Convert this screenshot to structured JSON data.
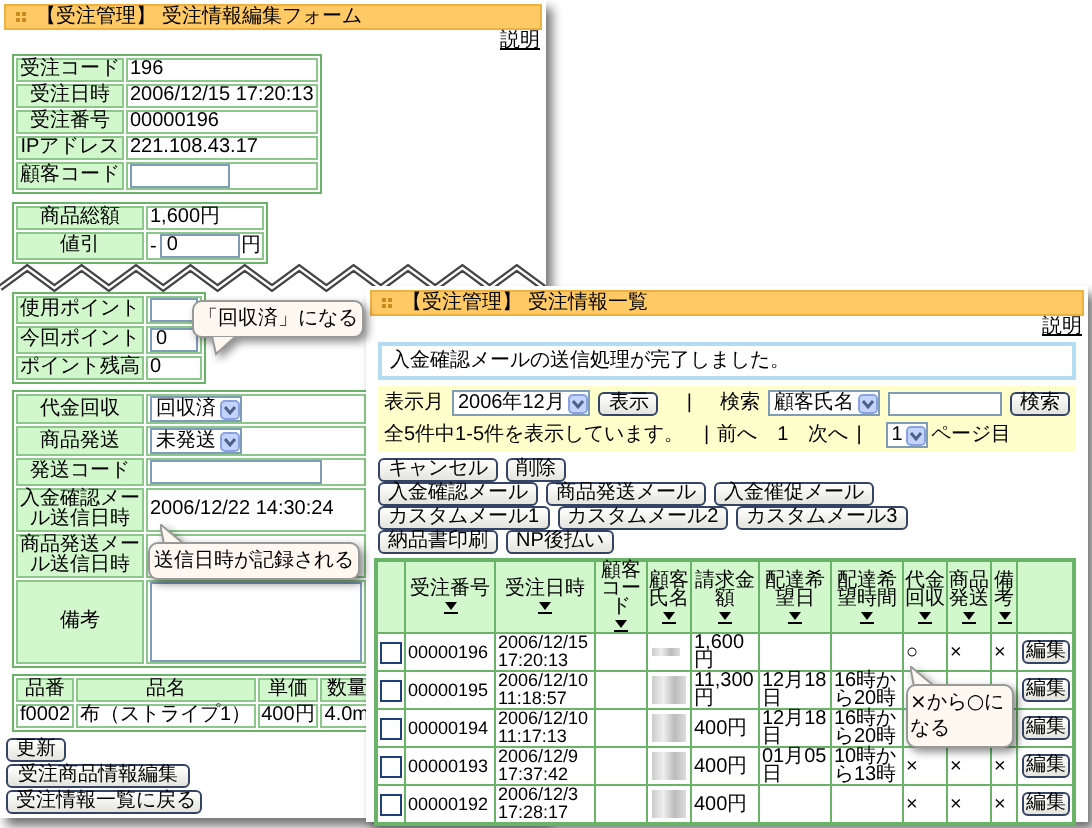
{
  "edit_window": {
    "title": "【受注管理】 受注情報編集フォーム",
    "help_link": "説明",
    "order_info": [
      {
        "kind": "text",
        "label": "受注コード",
        "value": "196"
      },
      {
        "kind": "text",
        "label": "受注日時",
        "value": "2006/12/15 17:20:13"
      },
      {
        "kind": "text",
        "label": "受注番号",
        "value": "00000196"
      },
      {
        "kind": "text",
        "label": "IPアドレス",
        "value": "221.108.43.17"
      },
      {
        "kind": "input",
        "label": "顧客コード"
      }
    ],
    "price_info": [
      {
        "kind": "text",
        "label": "商品総額",
        "value": "1,600円"
      },
      {
        "kind": "discount",
        "label": "値引",
        "prefix": "-",
        "value": "0",
        "unit": "円"
      }
    ],
    "point_info": [
      {
        "kind": "input",
        "label": "使用ポイント"
      },
      {
        "kind": "input",
        "label": "今回ポイント",
        "value": "0"
      },
      {
        "kind": "text",
        "label": "ポイント残高",
        "value": "0"
      }
    ],
    "status_info": [
      {
        "kind": "select",
        "label": "代金回収",
        "value": "回収済"
      },
      {
        "kind": "select",
        "label": "商品発送",
        "value": "未発送"
      },
      {
        "kind": "input",
        "label": "発送コード"
      },
      {
        "kind": "text",
        "label": "入金確認メール送信日時",
        "value": "2006/12/22 14:30:24"
      },
      {
        "kind": "text",
        "label": "商品発送メール送信日時"
      },
      {
        "kind": "textarea",
        "label": "備考"
      }
    ],
    "items": {
      "columns": [
        "品番",
        "品名",
        "単価",
        "数量"
      ],
      "rows": [
        [
          "f0002",
          "布（ストライプ1）",
          "400円",
          "4.0m"
        ]
      ]
    },
    "buttons": [
      "更新",
      "受注商品情報編集",
      "受注情報一覧に戻る"
    ]
  },
  "list_window": {
    "title": "【受注管理】 受注情報一覧",
    "help_link": "説明",
    "message": "入金確認メールの送信処理が完了しました。",
    "filter": {
      "month_label": "表示月",
      "month": "2006年12月",
      "show_button": "表示",
      "separator": "|",
      "search_label": "検索",
      "search_field": "顧客氏名",
      "search_button": "検索"
    },
    "paging": {
      "summary": "全5件中1-5件を表示しています。",
      "separator_left": "|",
      "prev": "前へ",
      "page": "1",
      "next": "次へ",
      "separator_right": "|",
      "page_select": "1",
      "page_suffix": "ページ目"
    },
    "button_rows": [
      [
        "キャンセル",
        "削除"
      ],
      [
        "入金確認メール",
        "商品発送メール",
        "入金催促メール"
      ],
      [
        "カスタムメール1",
        "カスタムメール2",
        "カスタムメール3"
      ],
      [
        "納品書印刷",
        "NP後払い"
      ]
    ],
    "table": {
      "columns": [
        "受注番号",
        "受注日時",
        "顧客コード",
        "顧客氏名",
        "請求金額",
        "配達希望日",
        "配達希望時間",
        "代金回収",
        "商品発送",
        "備考"
      ],
      "rows": [
        {
          "checked": false,
          "order_no": "00000196",
          "ordered_at": "2006/12/15 17:20:13",
          "amount": "1,600円",
          "payment": "○",
          "shipping": "×",
          "note": "×",
          "edit": "編集"
        },
        {
          "checked": false,
          "order_no": "00000195",
          "ordered_at": "2006/12/10 11:18:57",
          "amount": "11,300円",
          "delivery_date": "12月18日",
          "delivery_time": "16時から20時",
          "edit": "編集"
        },
        {
          "checked": false,
          "order_no": "00000194",
          "ordered_at": "2006/12/10 11:17:13",
          "amount": "400円",
          "delivery_date": "12月18日",
          "delivery_time": "16時から20時",
          "edit": "編集"
        },
        {
          "checked": false,
          "order_no": "00000193",
          "ordered_at": "2006/12/9 17:37:42",
          "amount": "400円",
          "delivery_date": "01月05日",
          "delivery_time": "10時から13時",
          "payment": "×",
          "shipping": "×",
          "note": "×",
          "edit": "編集"
        },
        {
          "checked": false,
          "order_no": "00000192",
          "ordered_at": "2006/12/3 17:28:17",
          "amount": "400円",
          "payment": "×",
          "shipping": "×",
          "note": "×",
          "edit": "編集"
        }
      ]
    }
  },
  "callouts": [
    {
      "text": "「回収済」になる"
    },
    {
      "text": "送信日時が記録される"
    },
    {
      "text": "×から○になる"
    }
  ]
}
